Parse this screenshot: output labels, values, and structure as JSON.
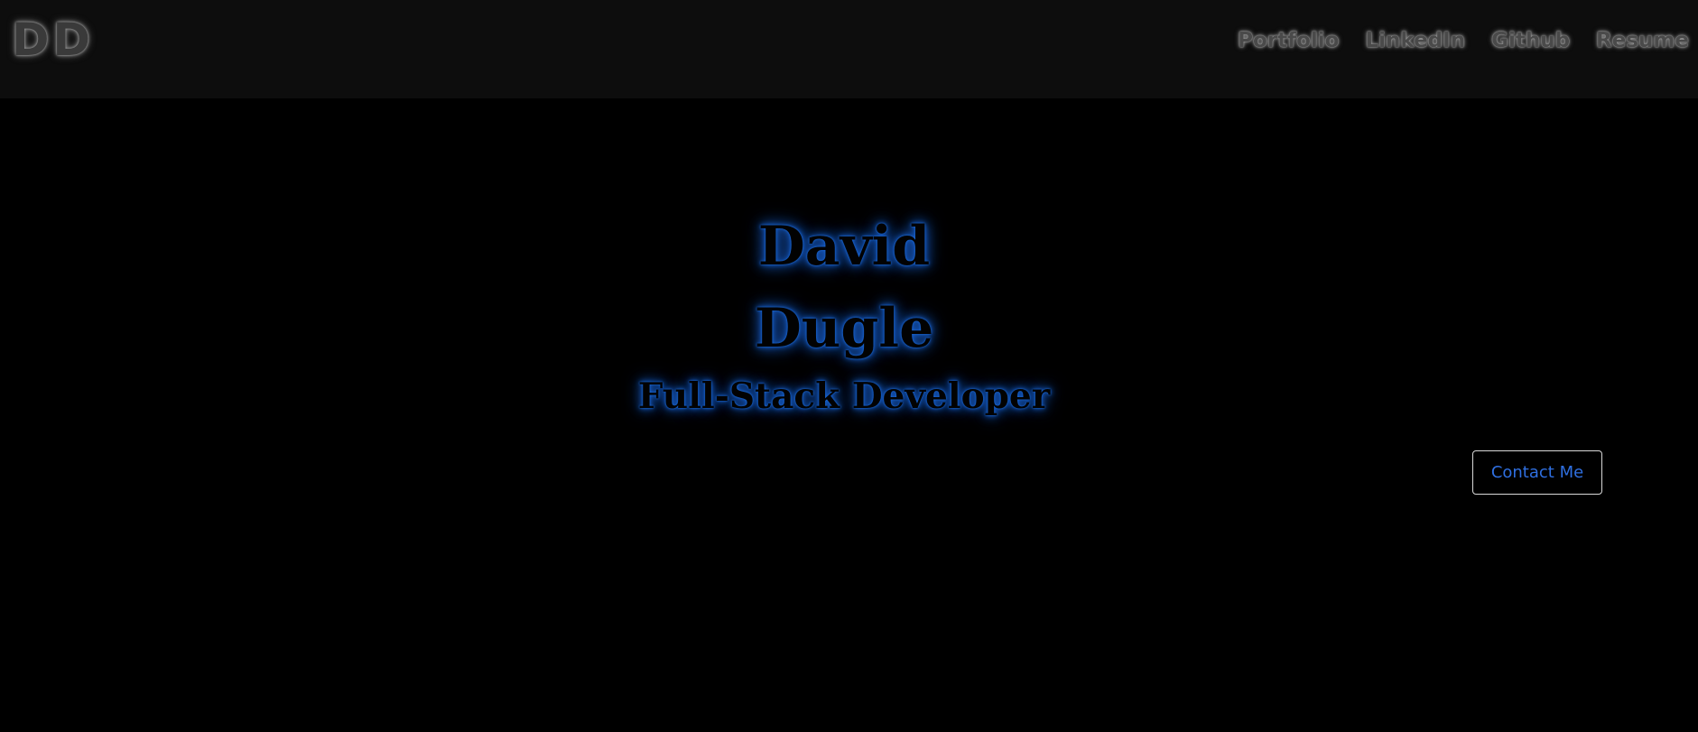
{
  "header": {
    "logo": "DD",
    "nav": [
      {
        "label": "Portfolio"
      },
      {
        "label": "LinkedIn"
      },
      {
        "label": "Github"
      },
      {
        "label": "Resume"
      }
    ]
  },
  "hero": {
    "first_name": "David",
    "last_name": "Dugle",
    "subtitle": "Full-Stack Developer",
    "contact_label": "Contact Me"
  },
  "colors": {
    "background": "#000000",
    "header_background": "#0d0d0d",
    "glow_accent": "#1e6fe0",
    "button_text": "#2f6fe0",
    "button_border": "#d8d8d8"
  }
}
